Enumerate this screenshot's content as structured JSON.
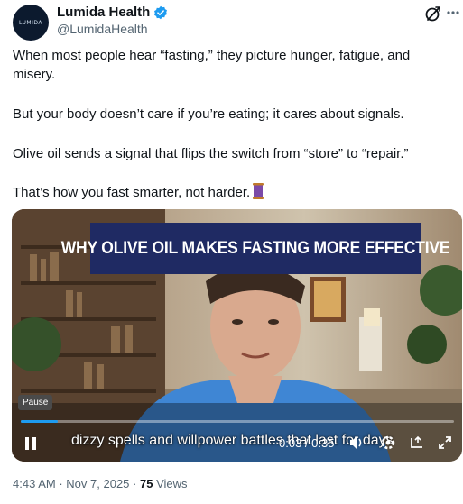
{
  "author": {
    "name": "Lumida Health",
    "handle": "@LumidaHealth",
    "avatar_text": "LUMIDA",
    "verified_color": "#1d9bf0"
  },
  "tweet": {
    "p1": "When most people hear “fasting,” they picture hunger, fatigue, and misery.",
    "p2": "But your body doesn’t care if you’re eating; it cares about signals.",
    "p3": "Olive oil sends a signal that flips the switch from “store” to “repair.”",
    "p4": "That’s how you fast smarter, not harder."
  },
  "video": {
    "banner_text": "WHY OLIVE OIL MAKES FASTING MORE EFFECTIVE",
    "banner_color": "#1f2a63",
    "pause_tooltip": "Pause",
    "caption": "dizzy spells and willpower battles that last for days",
    "time": "0:03 / 0:35",
    "progress": 0.086,
    "accent": "#1d9bf0"
  },
  "meta": {
    "time": "4:43 AM",
    "sep": "·",
    "date": "Nov 7, 2025",
    "views": "75",
    "views_label": "Views"
  }
}
